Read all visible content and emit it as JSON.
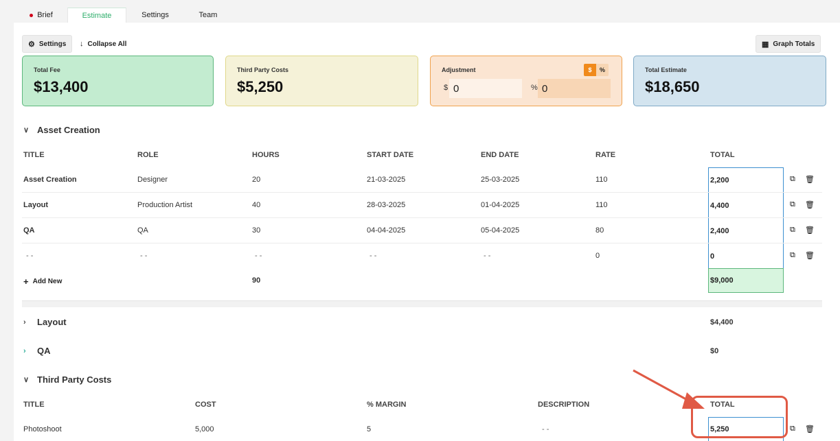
{
  "tabs": [
    {
      "label": "Brief",
      "has_dot": true
    },
    {
      "label": "Estimate",
      "active": true
    },
    {
      "label": "Settings"
    },
    {
      "label": "Team"
    }
  ],
  "toolbar": {
    "settings_label": "Settings",
    "collapse_label": "Collapse All",
    "graph_label": "Graph Totals"
  },
  "cards": {
    "fee": {
      "label": "Total Fee",
      "value": "$13,400"
    },
    "third": {
      "label": "Third Party Costs",
      "value": "$5,250"
    },
    "adjustment": {
      "label": "Adjustment",
      "toggle_on": "$",
      "toggle_off": "%",
      "dollar_symbol": "$",
      "dollar_value": "0",
      "percent_symbol": "%",
      "percent_value": "0"
    },
    "total": {
      "label": "Total Estimate",
      "value": "$18,650"
    }
  },
  "asset_section": {
    "title": "Asset Creation",
    "columns": [
      "TITLE",
      "ROLE",
      "HOURS",
      "START DATE",
      "END DATE",
      "RATE",
      "TOTAL"
    ],
    "rows": [
      {
        "title": "Asset Creation",
        "role": "Designer",
        "hours": "20",
        "start": "21-03-2025",
        "end": "25-03-2025",
        "rate": "110",
        "total": "2,200"
      },
      {
        "title": "Layout",
        "role": "Production Artist",
        "hours": "40",
        "start": "28-03-2025",
        "end": "01-04-2025",
        "rate": "110",
        "total": "4,400"
      },
      {
        "title": "QA",
        "role": "QA",
        "hours": "30",
        "start": "04-04-2025",
        "end": "05-04-2025",
        "rate": "80",
        "total": "2,400"
      },
      {
        "title": "- -",
        "role": "- -",
        "hours": "- -",
        "start": "- -",
        "end": "- -",
        "rate": "0",
        "total": "0"
      }
    ],
    "add_new_label": "Add New",
    "hours_sum": "90",
    "total_sum": "$9,000"
  },
  "collapsed_sections": [
    {
      "title": "Layout",
      "total": "$4,400"
    },
    {
      "title": "QA",
      "total": "$0"
    }
  ],
  "third_party_section": {
    "title": "Third Party Costs",
    "columns": [
      "TITLE",
      "COST",
      "% MARGIN",
      "DESCRIPTION",
      "TOTAL"
    ],
    "rows": [
      {
        "title": "Photoshoot",
        "cost": "5,000",
        "margin": "5",
        "description": "- -",
        "total": "5,250"
      }
    ]
  },
  "colors": {
    "accent_green": "#2eae6b",
    "annotation_red": "#e05a45",
    "focus_blue": "#3c8fd0"
  }
}
